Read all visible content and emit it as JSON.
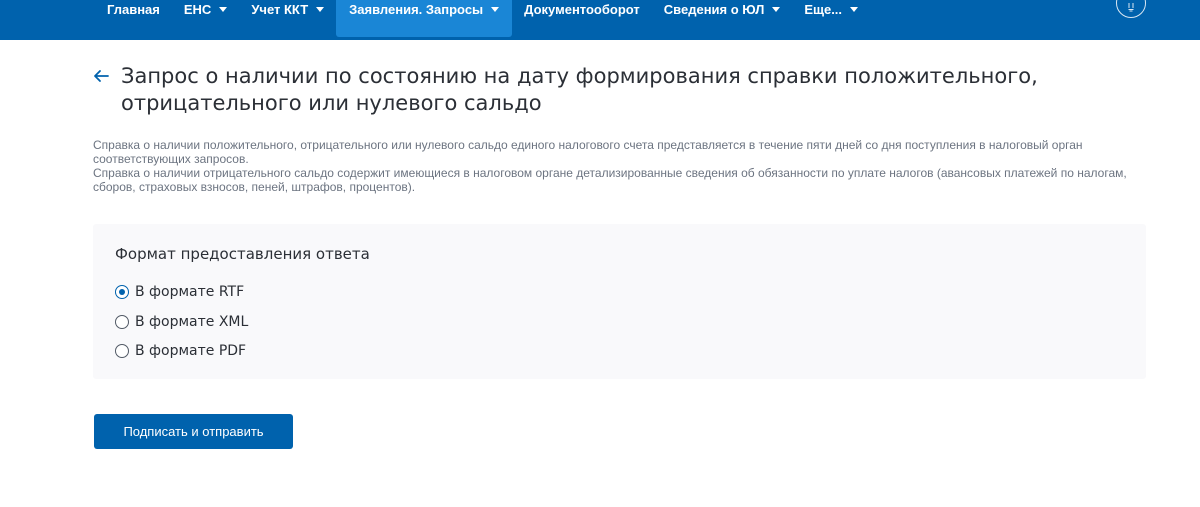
{
  "nav": {
    "items": [
      {
        "label": "Главная",
        "has_dropdown": false,
        "active": false
      },
      {
        "label": "ЕНС",
        "has_dropdown": true,
        "active": false
      },
      {
        "label": "Учет ККТ",
        "has_dropdown": true,
        "active": false
      },
      {
        "label": "Заявления. Запросы",
        "has_dropdown": true,
        "active": true
      },
      {
        "label": "Документооборот",
        "has_dropdown": false,
        "active": false
      },
      {
        "label": "Сведения о ЮЛ",
        "has_dropdown": true,
        "active": false
      },
      {
        "label": "Еще...",
        "has_dropdown": true,
        "active": false
      }
    ],
    "profile_icon": "lightbulb-icon"
  },
  "page": {
    "back_icon": "arrow-left-icon",
    "title": "Запрос о наличии по состоянию на дату формирования справки положительного, отрицательного или нулевого сальдо",
    "description": [
      "Справка о наличии положительного, отрицательного или нулевого сальдо единого налогового счета представляется в течение пяти дней со дня поступления в налоговый орган соответствующих запросов.",
      "Справка о наличии отрицательного сальдо содержит имеющиеся в налоговом органе детализированные сведения об обязанности по уплате налогов (авансовых платежей по налогам, сборов, страховых взносов, пеней, штрафов, процентов)."
    ]
  },
  "format": {
    "label": "Формат предоставления ответа",
    "options": [
      {
        "label": "В формате RTF",
        "checked": true
      },
      {
        "label": "В формате XML",
        "checked": false
      },
      {
        "label": "В формате PDF",
        "checked": false
      }
    ]
  },
  "actions": {
    "submit_label": "Подписать и отправить"
  },
  "colors": {
    "nav_bg": "#0062ad",
    "nav_active_bg": "#1a86d6",
    "accent": "#0062ad",
    "text": "#2b2f36",
    "muted_text": "#6c7481",
    "panel_bg": "#f9f9fb"
  }
}
